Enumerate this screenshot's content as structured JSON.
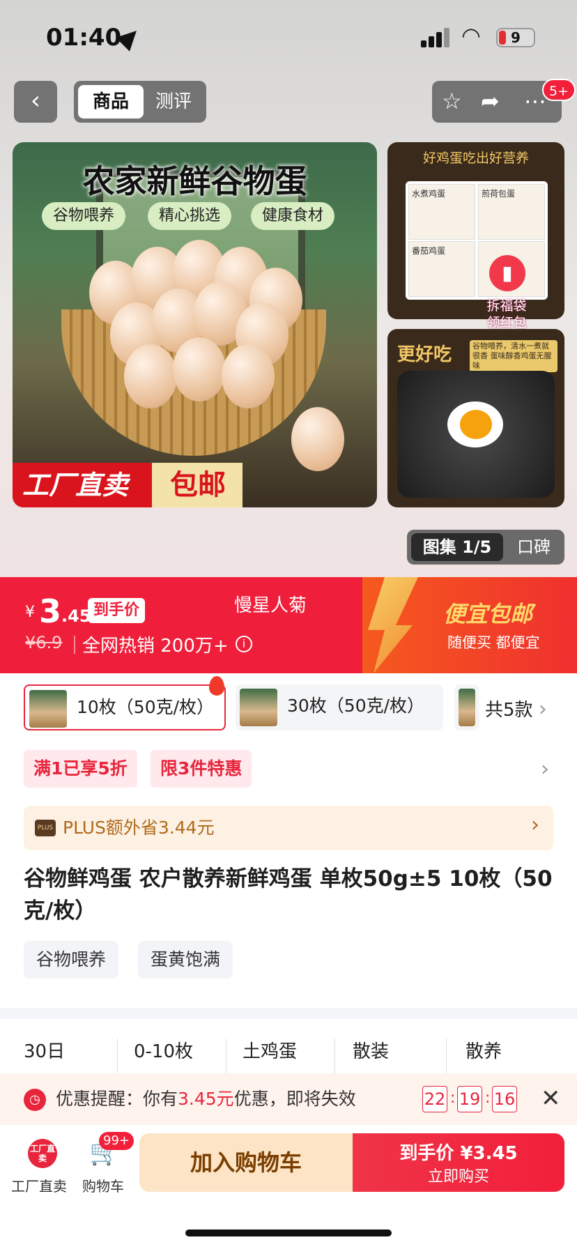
{
  "status_bar": {
    "time": "01:40",
    "battery": "9"
  },
  "nav": {
    "back_icon": "chevron-left-icon",
    "tabs": [
      {
        "label": "商品"
      },
      {
        "label": "测评"
      }
    ],
    "actions_badge": "5+"
  },
  "hero": {
    "title": "农家新鲜谷物蛋",
    "tags": [
      "谷物喂养",
      "精心挑选",
      "健康食材"
    ],
    "banner_left": "工厂直卖",
    "banner_right": "包邮"
  },
  "thumb1": {
    "title": "好鸡蛋吃出好营养",
    "cells": [
      "水煮鸡蛋",
      "煎荷包蛋",
      "番茄鸡蛋",
      ""
    ]
  },
  "fortune": {
    "line1": "拆福袋",
    "line2": "领红包"
  },
  "thumb2": {
    "title": "更好吃",
    "subtitle": "谷物喂养，清水一煮就很香 蛋味醇香鸡蛋无腥味"
  },
  "gallery": {
    "active": "图集 1/5",
    "inactive": "口碑"
  },
  "price": {
    "currency": "¥",
    "integer": "3",
    "decimal": ".45",
    "tag": "到手价",
    "seller": "慢星人菊",
    "original": "¥6.9",
    "sales": "全网热销 200万+",
    "promo_title": "便宜包邮",
    "promo_sub": "随便买 都便宜"
  },
  "variants": [
    {
      "label": "10枚（50克/枚）",
      "selected": true
    },
    {
      "label": "30枚（50克/枚）",
      "selected": false
    }
  ],
  "variants_more": "共5款",
  "coupons": [
    "满1已享5折",
    "限3件特惠"
  ],
  "plus": {
    "logo": "PLUS",
    "text": "PLUS额外省3.44元"
  },
  "product_title": "谷物鲜鸡蛋 农户散养新鲜鸡蛋 单枚50g±5 10枚（50克/枚）",
  "product_tags": [
    "谷物喂养",
    "蛋黄饱满"
  ],
  "specs": [
    "30日",
    "0-10枚",
    "土鸡蛋",
    "散装",
    "散养"
  ],
  "reminder": {
    "prefix": "优惠提醒：你有",
    "amount": "3.45元",
    "suffix": "优惠，即将失效",
    "hh": "22",
    "mm": "19",
    "ss": "16"
  },
  "bottom": {
    "factory_icon_text": "工厂直卖",
    "factory_label": "工厂直卖",
    "cart_badge": "99+",
    "cart_label": "购物车",
    "add_cart": "加入购物车",
    "buy_line1": "到手价 ¥3.45",
    "buy_line2": "立即购买"
  },
  "colors": {
    "accent": "#ef1f3b",
    "plus_text": "#b06a1a"
  }
}
